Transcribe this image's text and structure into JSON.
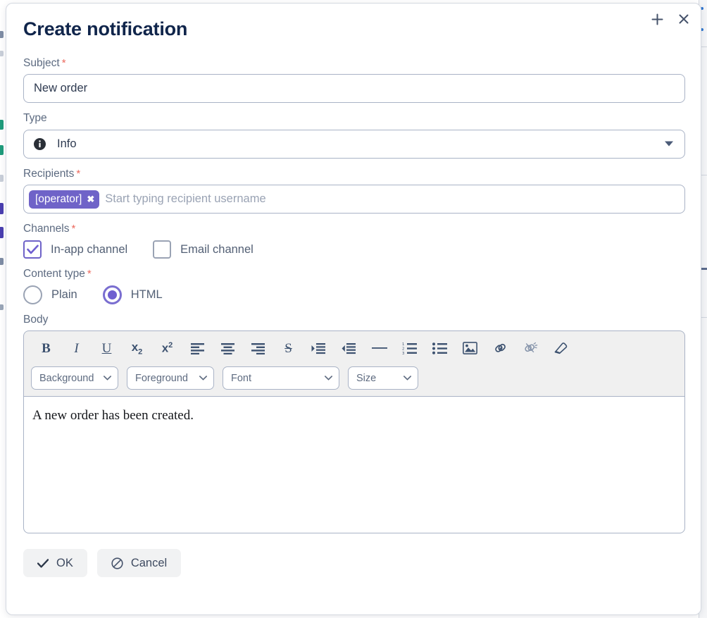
{
  "window": {
    "add_icon": "plus-icon",
    "close_icon": "close-icon"
  },
  "dialog": {
    "title": "Create notification"
  },
  "fields": {
    "subject": {
      "label": "Subject",
      "required": true,
      "value": "New order",
      "placeholder": ""
    },
    "type": {
      "label": "Type",
      "required": false,
      "value": "Info",
      "icon": "info-circle-icon",
      "caret": "chevron-down-icon"
    },
    "recipients": {
      "label": "Recipients",
      "required": true,
      "chips": [
        {
          "label": "[operator]",
          "remove_icon": "chip-remove-icon"
        }
      ],
      "placeholder": "Start typing recipient username"
    },
    "channels": {
      "label": "Channels",
      "required": true,
      "options": [
        {
          "label": "In-app channel",
          "checked": true
        },
        {
          "label": "Email channel",
          "checked": false
        }
      ]
    },
    "content_type": {
      "label": "Content type",
      "required": true,
      "options": [
        {
          "label": "Plain",
          "selected": false
        },
        {
          "label": "HTML",
          "selected": true
        }
      ]
    },
    "body": {
      "label": "Body",
      "required": false,
      "value": "A new order has been created."
    }
  },
  "editor": {
    "toolbar_icons": [
      {
        "name": "bold-icon",
        "glyph": "B"
      },
      {
        "name": "italic-icon",
        "glyph": "I"
      },
      {
        "name": "underline-icon",
        "glyph": "U"
      },
      {
        "name": "subscript-icon",
        "glyph": "x2"
      },
      {
        "name": "superscript-icon",
        "glyph": "x2"
      },
      {
        "name": "align-left-icon",
        "glyph": ""
      },
      {
        "name": "align-center-icon",
        "glyph": ""
      },
      {
        "name": "align-right-icon",
        "glyph": ""
      },
      {
        "name": "strikethrough-icon",
        "glyph": "S"
      },
      {
        "name": "indent-icon",
        "glyph": ""
      },
      {
        "name": "outdent-icon",
        "glyph": ""
      },
      {
        "name": "horizontal-rule-icon",
        "glyph": ""
      },
      {
        "name": "ordered-list-icon",
        "glyph": ""
      },
      {
        "name": "unordered-list-icon",
        "glyph": ""
      },
      {
        "name": "insert-image-icon",
        "glyph": ""
      },
      {
        "name": "insert-link-icon",
        "glyph": ""
      },
      {
        "name": "remove-link-icon",
        "glyph": ""
      },
      {
        "name": "clear-formatting-icon",
        "glyph": ""
      }
    ],
    "selects": [
      {
        "name": "background-color-select",
        "label": "Background"
      },
      {
        "name": "foreground-color-select",
        "label": "Foreground"
      },
      {
        "name": "font-family-select",
        "label": "Font"
      },
      {
        "name": "font-size-select",
        "label": "Size"
      }
    ]
  },
  "footer": {
    "ok_label": "OK",
    "ok_icon": "check-icon",
    "cancel_label": "Cancel",
    "cancel_icon": "ban-icon"
  },
  "colors": {
    "accent_purple": "#6f63c8",
    "radio_purple": "#6f5fd0",
    "title_navy": "#10254b",
    "label_gray": "#5c6a80",
    "required_red": "#ec6a5e",
    "border_gray": "#a9b3c6",
    "toolbar_bg": "#f0f0f0",
    "button_bg": "#f1f2f3"
  }
}
